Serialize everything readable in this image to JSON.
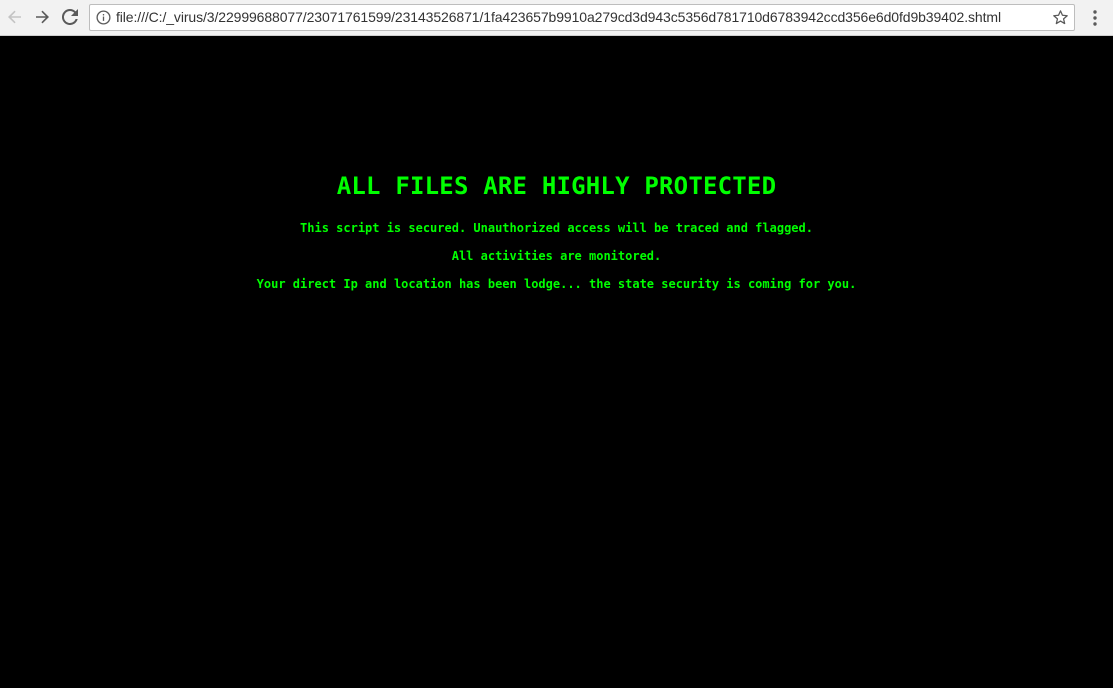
{
  "browser": {
    "url": "file:///C:/_virus/3/22999688077/23071761599/23143526871/1fa423657b9910a279cd3d943c5356d781710d6783942ccd356e6d0fd9b39402.shtml",
    "icons": [
      "back-arrow-icon",
      "forward-arrow-icon",
      "reload-icon",
      "info-icon",
      "star-icon",
      "menu-icon"
    ]
  },
  "page": {
    "headline_glyph": "",
    "headline": "ALL FILES ARE HIGHLY PROTECTED",
    "lines": [
      "This script is secured. Unauthorized access will be traced and flagged.",
      "All activities are monitored.",
      "Your direct Ip and location has been lodge... the state security is coming for you."
    ]
  },
  "colors": {
    "background": "#000000",
    "text": "#00ff00",
    "toolbar": "#f2f2f2"
  }
}
